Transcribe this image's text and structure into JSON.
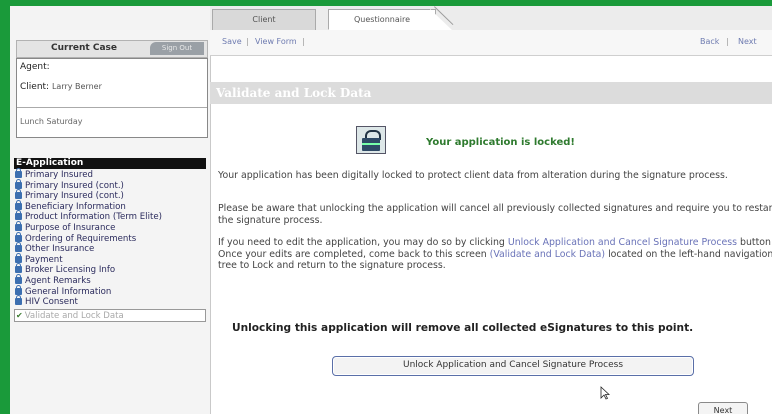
{
  "tabs": [
    {
      "label": "Client"
    },
    {
      "label": "Questionnaire"
    }
  ],
  "sidebar": {
    "current_case_label": "Current Case",
    "sign_out_label": "Sign Out",
    "agent_label": "Agent:",
    "client_label": "Client:",
    "client_name": "Larry Berner",
    "case_note": "Lunch Saturday",
    "eapp_header": "E-Application",
    "items": [
      {
        "label": "Primary Insured"
      },
      {
        "label": "Primary Insured (cont.)"
      },
      {
        "label": "Primary Insured (cont.)"
      },
      {
        "label": "Beneficiary Information"
      },
      {
        "label": "Product Information (Term Elite)"
      },
      {
        "label": "Purpose of Insurance"
      },
      {
        "label": "Ordering of Requirements"
      },
      {
        "label": "Other Insurance"
      },
      {
        "label": "Payment"
      },
      {
        "label": "Broker Licensing Info"
      },
      {
        "label": "Agent Remarks"
      },
      {
        "label": "General Information"
      },
      {
        "label": "HIV Consent"
      },
      {
        "label": "Validate and Lock Data"
      }
    ]
  },
  "toolbar": {
    "save": "Save",
    "view_form": "View Form",
    "back": "Back",
    "next": "Next"
  },
  "main": {
    "title": "Validate and Lock Data",
    "locked_message": "Your application is locked!",
    "para1": "Your application has been digitally locked to protect client data from alteration during the signature process.",
    "para2": "Please be aware that unlocking the application will cancel all previously collected signatures and require you to restart the signature process.",
    "para3_a": "If you need to edit the application, you may do so by clicking ",
    "para3_link1": "Unlock Application and Cancel Signature Process",
    "para3_b": " button. Once your edits are completed, come back to this screen ",
    "para3_link2": "(Validate and Lock Data)",
    "para3_c": " located on the left-hand navigation tree to Lock and return to the signature process.",
    "warning": "Unlocking this application will remove all collected eSignatures to this point.",
    "unlock_button": "Unlock Application and Cancel Signature Process",
    "next_button": "Next"
  }
}
